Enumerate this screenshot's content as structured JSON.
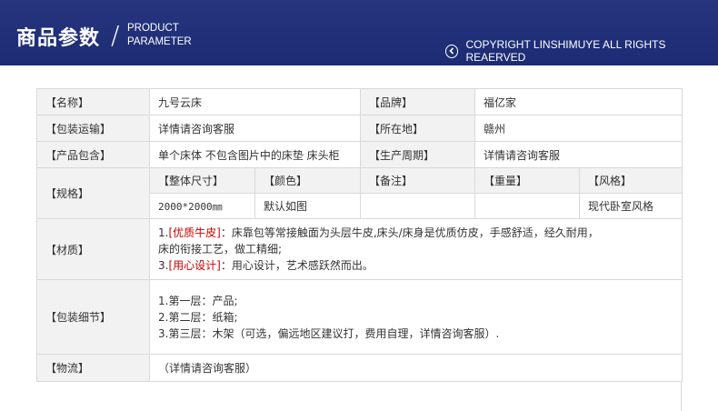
{
  "header": {
    "title_cn": "商品参数",
    "slash": "/",
    "title_en_1": "PRODUCT",
    "title_en_2": "PARAMETER",
    "copyright": "COPYRIGHT LINSHIMUYE ALL RIGHTS REAERVED",
    "bg_color": "#1c2b73"
  },
  "rows": {
    "name": {
      "label": "【名称】",
      "value": "九号云床"
    },
    "brand": {
      "label": "【品牌】",
      "value": "福亿家"
    },
    "shipping": {
      "label": "【包装运输】",
      "value": "详情请咨询客服"
    },
    "location": {
      "label": "【所在地】",
      "value": "赣州"
    },
    "includes": {
      "label": "【产品包含】",
      "value": "单个床体 不包含图片中的床垫 床头柜"
    },
    "period": {
      "label": "【生产周期】",
      "value": "详情请咨询客服"
    },
    "spec": {
      "label": "【规格】",
      "size_label": "【整体尺寸】",
      "color_label": "【颜色】",
      "note_label": "【备注】",
      "weight_label": "【重量】",
      "style_label": "【风格】",
      "size_value": "2000*2000㎜",
      "color_value": "默认如图",
      "note_value": "",
      "weight_value": "",
      "style_value": "现代卧室风格"
    },
    "material": {
      "label": "【材质】",
      "l1_num": "1.",
      "l1_tag": "[优质牛皮]",
      "l1_text": "：床靠包等常接触面为头层牛皮,床头/床身是优质仿皮，手感舒适，经久耐用，",
      "l2_text": "床的衔接工艺，做工精细;",
      "l3_num": "3.",
      "l3_tag": "[用心设计]",
      "l3_text": "：用心设计，艺术感跃然而出。",
      "accent_color": "#cc0000"
    },
    "packaging": {
      "label": "【包装细节】",
      "l1": "1.第一层：产品;",
      "l2": "2.第二层：纸箱;",
      "l3": "3.第三层：木架（可选，偏远地区建议打，费用自理，详情咨询客服）."
    },
    "logistics": {
      "label": "【物流】",
      "value": "（详情请咨询客服）"
    }
  }
}
